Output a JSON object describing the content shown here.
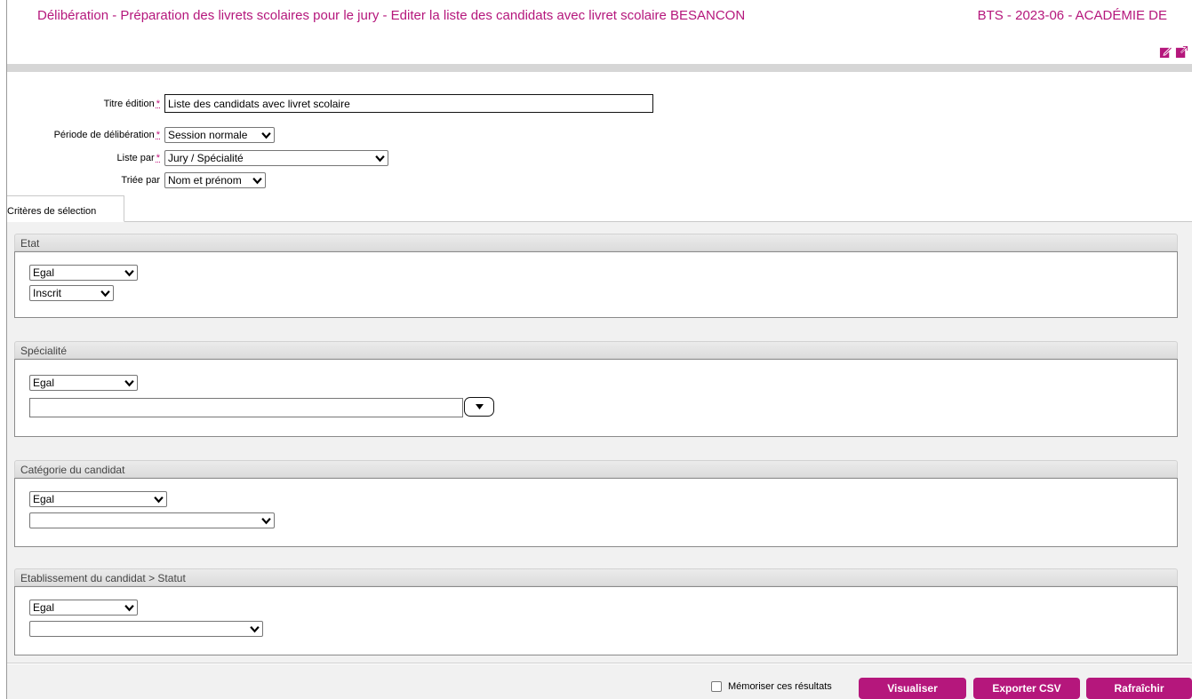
{
  "header": {
    "title": "Délibération - Préparation des livrets scolaires pour le jury - Editer la liste des candidats avec livret scolaire BESANCON",
    "context": "BTS - 2023-06 - ACADÉMIE DE",
    "icons": [
      "edit-icon",
      "external-link-icon"
    ]
  },
  "form": {
    "required_mark": "*",
    "titre": {
      "label": "Titre édition",
      "value": "Liste des candidats avec livret scolaire"
    },
    "periode": {
      "label": "Période de délibération",
      "value": "Session normale"
    },
    "liste_par": {
      "label": "Liste par",
      "value": "Jury / Spécialité"
    },
    "triee_par": {
      "label": "Triée par",
      "value": "Nom et prénom"
    }
  },
  "tabs": [
    {
      "label": "Critères de sélection"
    }
  ],
  "criteria": {
    "etat": {
      "title": "Etat",
      "operator": "Egal",
      "value": "Inscrit"
    },
    "specialite": {
      "title": "Spécialité",
      "operator": "Egal",
      "value": ""
    },
    "categorie": {
      "title": "Catégorie du candidat",
      "operator": "Egal",
      "value": ""
    },
    "etablissement": {
      "title": "Etablissement du candidat > Statut",
      "operator": "Egal",
      "value": ""
    }
  },
  "footer": {
    "remember_label": "Mémoriser ces résultats",
    "visualiser": "Visualiser",
    "exporter": "Exporter CSV",
    "rafraichir": "Rafraîchir"
  },
  "colors": {
    "accent": "#b5177c",
    "band": "#d6d6d6",
    "criteria_bg": "#f1f1f1"
  }
}
